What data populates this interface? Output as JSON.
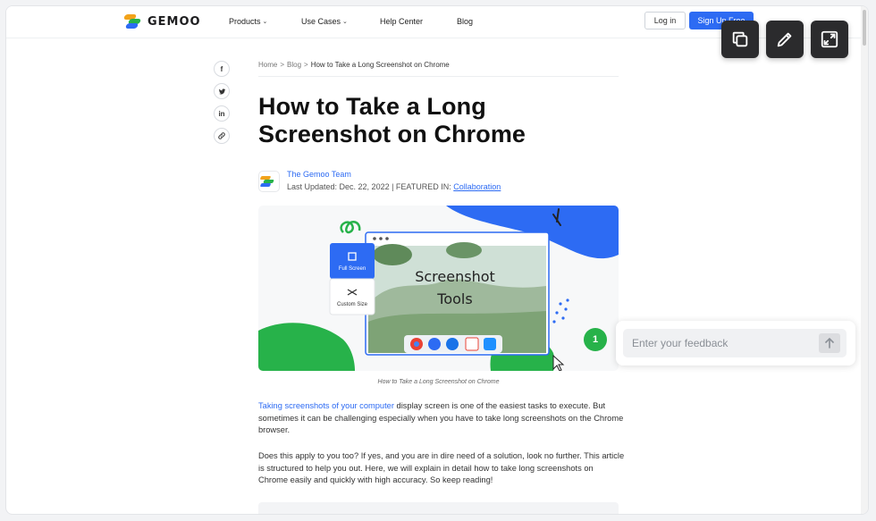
{
  "nav": {
    "logo_text": "GEMOO",
    "items": [
      {
        "label": "Products",
        "has_menu": true
      },
      {
        "label": "Use Cases",
        "has_menu": true
      },
      {
        "label": "Help Center",
        "has_menu": false
      },
      {
        "label": "Blog",
        "has_menu": false
      }
    ],
    "login_label": "Log in",
    "signup_label": "Sign Up Free"
  },
  "toolbar": {
    "icons": [
      "copy-icon",
      "edit-pencil-icon",
      "expand-icon"
    ]
  },
  "share": [
    "f",
    "t",
    "in",
    "link"
  ],
  "breadcrumb": {
    "home": "Home",
    "sep": ">",
    "blog": "Blog",
    "current": "How to Take a Long Screenshot on Chrome"
  },
  "article": {
    "title": "How to Take a Long Screenshot on Chrome",
    "author": "The Gemoo Team",
    "updated_prefix": "Last Updated: Dec. 22, 2022 | FEATURED IN: ",
    "featured_link": "Collaboration",
    "hero": {
      "panel_full": "Full Screen",
      "panel_custom": "Custom Size",
      "screen_line1": "Screenshot",
      "screen_line2": "Tools"
    },
    "caption": "How to Take a Long Screenshot on Chrome",
    "p1_link": "Taking screenshots of your computer",
    "p1_rest": " display screen is one of the easiest tasks to execute. But sometimes it can be challenging especially when you have to take long screenshots on the Chrome browser.",
    "p2": "Does this apply to you too? If yes, and you are in dire need of a solution, look no further. This article is structured to help you out. Here, we will explain in detail how to take long screenshots on Chrome easily and quickly with high accuracy. So keep reading!"
  },
  "feedback": {
    "placeholder": "Enter your feedback",
    "badge_count": "1"
  },
  "colors": {
    "accent_blue": "#2d6bf3",
    "green": "#27b24a",
    "dark_tool": "#2b2b2d"
  }
}
